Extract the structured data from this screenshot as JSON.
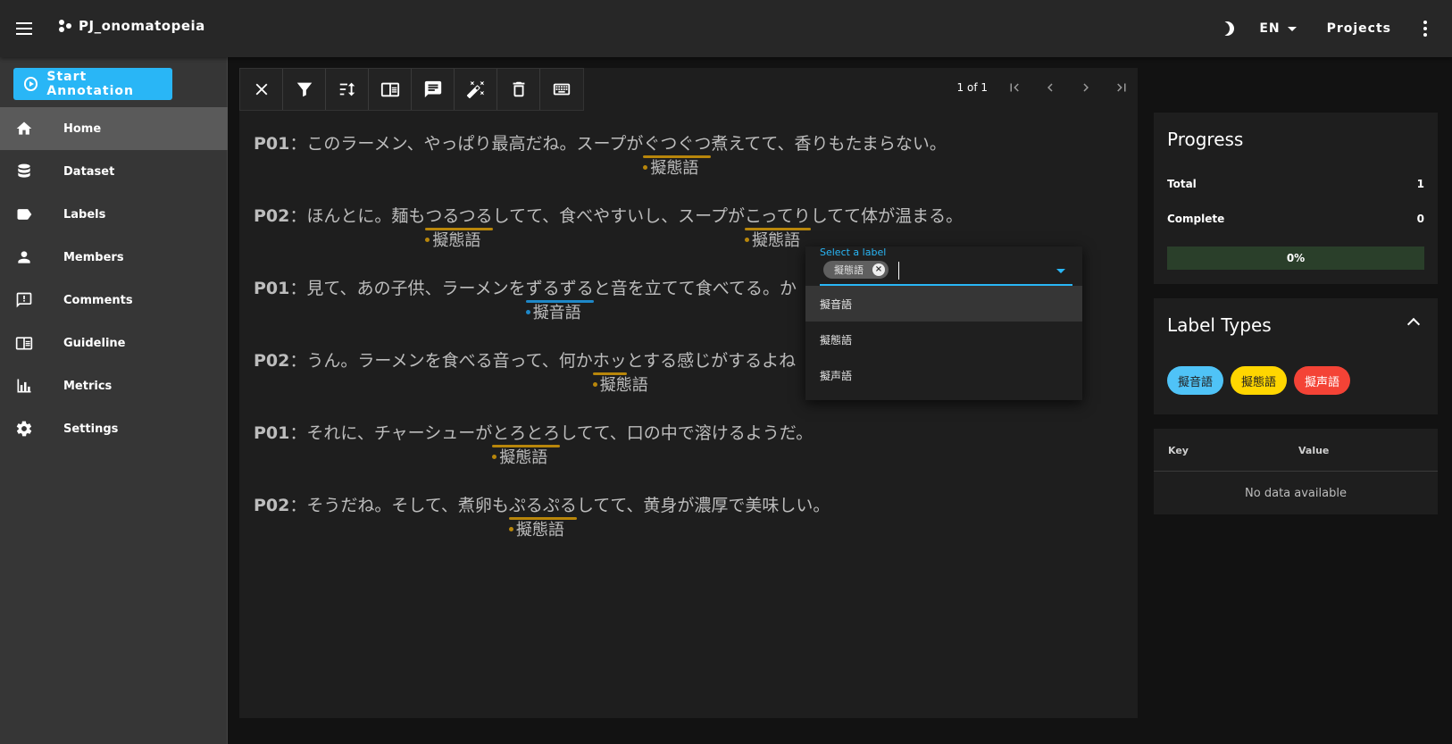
{
  "app": {
    "project_name": "PJ_onomatopeia"
  },
  "topbar": {
    "language": "EN",
    "projects_label": "Projects"
  },
  "sidebar": {
    "start_label": "Start Annotation",
    "items": [
      {
        "label": "Home",
        "icon": "home-icon",
        "active": true
      },
      {
        "label": "Dataset",
        "icon": "database-icon"
      },
      {
        "label": "Labels",
        "icon": "label-icon"
      },
      {
        "label": "Members",
        "icon": "person-icon"
      },
      {
        "label": "Comments",
        "icon": "comment-icon"
      },
      {
        "label": "Guideline",
        "icon": "book-icon"
      },
      {
        "label": "Metrics",
        "icon": "chart-icon"
      },
      {
        "label": "Settings",
        "icon": "gear-icon"
      }
    ]
  },
  "pager": {
    "text": "1 of 1"
  },
  "lines": [
    {
      "speaker": "P01",
      "sep": "：",
      "before": "このラーメン、やっぱり最高だね。スープが",
      "span": "ぐつぐつ",
      "span_label": "擬態語",
      "after": "煮えてて、香りもたまらない。"
    },
    {
      "speaker": "P02",
      "sep": "：",
      "before": "ほんとに。麺も",
      "span": "つるつる",
      "span_label": "擬態語",
      "middle": "してて、食べやすいし、スープが",
      "span2": "こってり",
      "span2_label": "擬態語",
      "after": "してて体が温まる。"
    },
    {
      "speaker": "P01",
      "sep": "：",
      "before": "見て、あの子供、ラーメンを",
      "span": "ずるずる",
      "span_label": "擬音語",
      "after": "と音を立てて食べてる。か"
    },
    {
      "speaker": "P02",
      "sep": "：",
      "before": "うん。ラーメンを食べる音って、何か",
      "span": "ホッ",
      "span_label": "擬態語",
      "after": "とする感じがするよね"
    },
    {
      "speaker": "P01",
      "sep": "：",
      "before": "それに、チャーシューが",
      "span": "とろとろ",
      "span_label": "擬態語",
      "after": "してて、口の中で溶けるようだ。"
    },
    {
      "speaker": "P02",
      "sep": "：",
      "before": "そうだね。そして、煮卵も",
      "span": "ぷるぷる",
      "span_label": "擬態語",
      "after": "してて、黄身が濃厚で美味しい。"
    }
  ],
  "dropdown": {
    "field_label": "Select a label",
    "selected_chip": "擬態語",
    "options": [
      "擬音語",
      "擬態語",
      "擬声語"
    ]
  },
  "progress": {
    "title": "Progress",
    "total_label": "Total",
    "total_value": "1",
    "complete_label": "Complete",
    "complete_value": "0",
    "percent_text": "0%"
  },
  "label_types": {
    "title": "Label Types",
    "labels": [
      {
        "text": "擬音語",
        "color": "#4fc3f7"
      },
      {
        "text": "擬態語",
        "color": "#ffd600"
      },
      {
        "text": "擬声語",
        "color": "#f44336"
      }
    ]
  },
  "metadata_table": {
    "key_header": "Key",
    "value_header": "Value",
    "empty_text": "No data available"
  },
  "colors": {
    "accent": "#29b6f6",
    "mimetic_underline": "#b8860b",
    "onomatopoeia_underline": "#1e88c8"
  }
}
